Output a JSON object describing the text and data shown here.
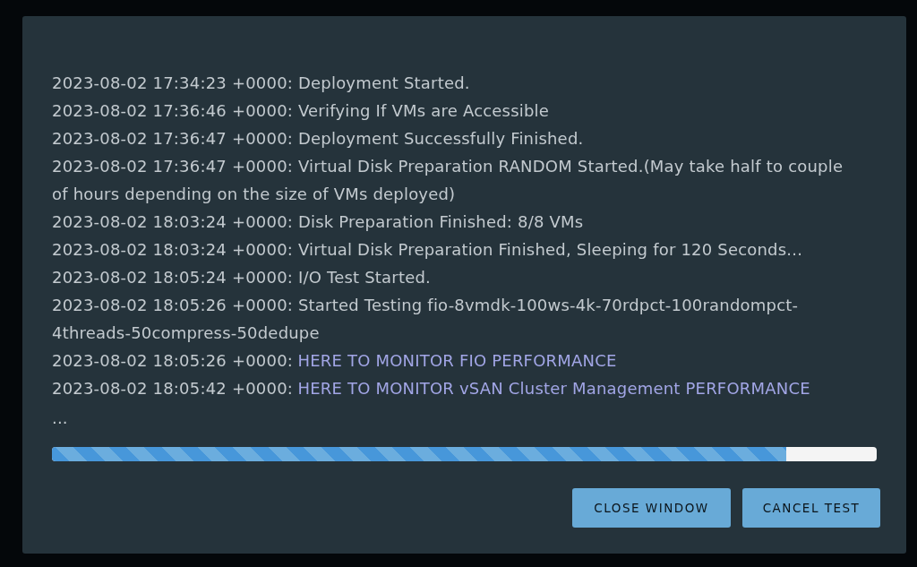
{
  "log": {
    "entries": [
      {
        "timestamp": "2023-08-02 17:34:23 +0000:",
        "message": "Deployment Started.",
        "kind": "text"
      },
      {
        "timestamp": "2023-08-02 17:36:46 +0000:",
        "message": "Verifying If VMs are Accessible",
        "kind": "text"
      },
      {
        "timestamp": "2023-08-02 17:36:47 +0000:",
        "message": "Deployment Successfully Finished.",
        "kind": "text"
      },
      {
        "timestamp": "2023-08-02 17:36:47 +0000:",
        "message": "Virtual Disk Preparation RANDOM Started.(May take half to couple of hours depending on the size of VMs deployed)",
        "kind": "text"
      },
      {
        "timestamp": "2023-08-02 18:03:24 +0000:",
        "message": "Disk Preparation Finished: 8/8 VMs",
        "kind": "text"
      },
      {
        "timestamp": "2023-08-02 18:03:24 +0000:",
        "message": "Virtual Disk Preparation Finished, Sleeping for 120 Seconds...",
        "kind": "text"
      },
      {
        "timestamp": "2023-08-02 18:05:24 +0000:",
        "message": "I/O Test Started.",
        "kind": "text"
      },
      {
        "timestamp": "2023-08-02 18:05:26 +0000:",
        "message": "Started Testing fio-8vmdk-100ws-4k-70rdpct-100randompct-4threads-50compress-50dedupe",
        "kind": "text"
      },
      {
        "timestamp": "2023-08-02 18:05:26 +0000:",
        "message": "HERE TO MONITOR FIO PERFORMANCE",
        "kind": "link"
      },
      {
        "timestamp": "2023-08-02 18:05:42 +0000:",
        "message": "HERE TO MONITOR vSAN Cluster Management PERFORMANCE",
        "kind": "link"
      }
    ],
    "more": "..."
  },
  "progress": {
    "level": 0.89
  },
  "buttons": [
    {
      "label": "CLOSE WINDOW"
    },
    {
      "label": "CANCEL TEST"
    }
  ]
}
